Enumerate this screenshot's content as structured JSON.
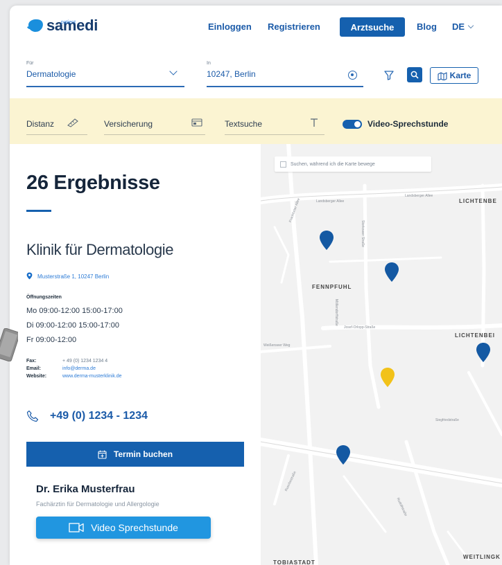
{
  "header": {
    "logo": "samedi",
    "logo_sub": "patient",
    "nav": {
      "login": "Einloggen",
      "register": "Registrieren",
      "doctor_search": "Arztsuche",
      "blog": "Blog",
      "language": "DE"
    }
  },
  "search": {
    "specialty_label": "Für",
    "specialty_value": "Dermatologie",
    "location_label": "In",
    "location_value": "10247, Berlin",
    "map_button": "Karte"
  },
  "filters": {
    "distance": "Distanz",
    "insurance": "Versicherung",
    "text_search": "Textsuche",
    "video_toggle": "Video-Sprechstunde",
    "video_toggle_on": true
  },
  "results": {
    "count": "26 Ergebnisse",
    "clinic_name": "Klinik für Dermatologie",
    "address": "Musterstraße 1, 10247 Berlin",
    "hours_label": "Öffnungszeiten",
    "hours": [
      "Mo 09:00-12:00 15:00-17:00",
      "Di 09:00-12:00 15:00-17:00",
      "Fr 09:00-12:00"
    ],
    "contact": {
      "fax_label": "Fax:",
      "fax_value": "+ 49 (0) 1234 1234 4",
      "email_label": "Email:",
      "email_value": "info@derma.de",
      "website_label": "Website:",
      "website_value": "www.derma-musterklinik.de"
    },
    "phone": "+49 (0) 1234 - 1234",
    "book_button": "Termin buchen",
    "doctor_name": "Dr. Erika Musterfrau",
    "doctor_specialty": "Fachärztin für Dermatologie und Allergologie",
    "video_button": "Video Sprechstunde"
  },
  "map": {
    "search_while_moving": "Suchen, während ich die Karte bewege",
    "labels": {
      "lichtenberg_top": "LICHTENBE",
      "fennpfuhl": "FENNPFUHL",
      "lichtenberg_mid": "LICHTENBEI",
      "weitlingkiez": "WEITLINGK",
      "tobiasstadt": "TOBIASTADT"
    },
    "streets": {
      "landsberger_1": "Landsberger Allee",
      "landsberger_2": "Landsberger Allee",
      "josef_orlopp": "Josef-Orlopp-Straße",
      "storkower": "Storkower Straße",
      "siegfried": "Siegfriedstraße",
      "frankfurter": "Frankfurter Allee",
      "moellendorff": "Möllendorffstraße",
      "ruschestr": "Ruschestraße",
      "weissenseer": "Weißenseer Weg",
      "rudower": "Rudolfstraße"
    }
  },
  "colors": {
    "primary": "#1560ae",
    "filter_bg": "#fbf4d2",
    "marker_blue": "#1459a3",
    "marker_yellow": "#f2c219",
    "video_button": "#2196e0"
  }
}
